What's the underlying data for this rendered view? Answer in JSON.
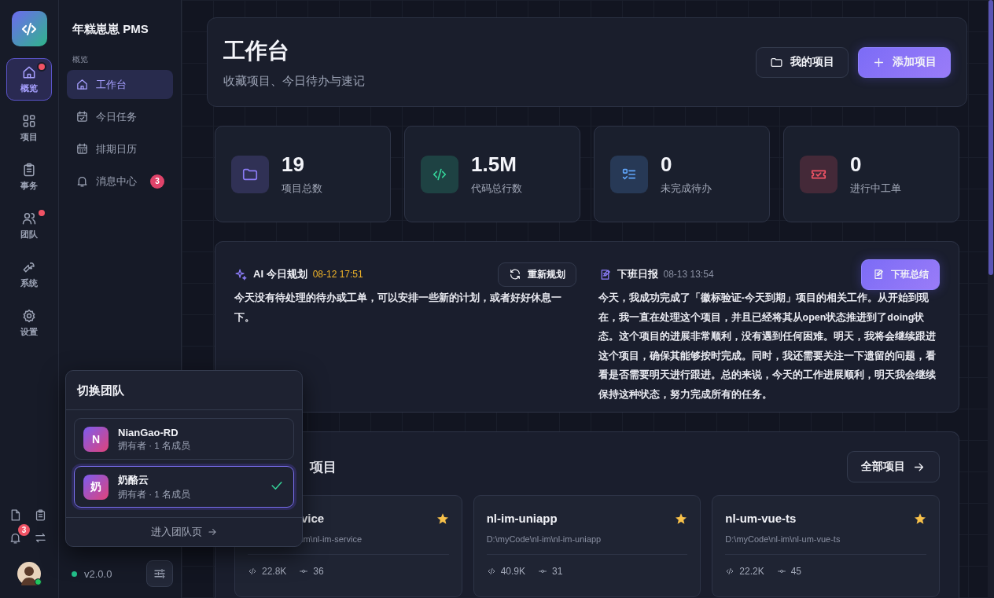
{
  "rail": {
    "items": [
      {
        "label": "概览",
        "selected": true,
        "dot": true
      },
      {
        "label": "项目",
        "selected": false,
        "dot": false
      },
      {
        "label": "事务",
        "selected": false,
        "dot": false
      },
      {
        "label": "团队",
        "selected": false,
        "dot": true
      },
      {
        "label": "系统",
        "selected": false,
        "dot": false
      },
      {
        "label": "设置",
        "selected": false,
        "dot": false
      }
    ],
    "bell_badge": "3",
    "online": true
  },
  "nav": {
    "title": "年糕崽崽 PMS",
    "section": "概览",
    "items": [
      {
        "label": "工作台",
        "selected": true
      },
      {
        "label": "今日任务",
        "selected": false
      },
      {
        "label": "排期日历",
        "selected": false
      },
      {
        "label": "消息中心",
        "selected": false,
        "badge": "3"
      }
    ],
    "version": "v2.0.0"
  },
  "header": {
    "title": "工作台",
    "subtitle": "收藏项目、今日待办与速记",
    "buttons": [
      {
        "label": "我的项目",
        "kind": "secondary"
      },
      {
        "label": "添加项目",
        "kind": "primary"
      }
    ]
  },
  "stats": [
    {
      "value": "19",
      "label": "项目总数",
      "color": "#8b7cf6"
    },
    {
      "value": "1.5M",
      "label": "代码总行数",
      "color": "#34d399"
    },
    {
      "value": "0",
      "label": "未完成待办",
      "color": "#60a5fa"
    },
    {
      "value": "0",
      "label": "进行中工单",
      "color": "#f05365"
    }
  ],
  "ai_plan": {
    "title": "AI 今日规划",
    "time": "08-12 17:51",
    "button": "重新规划",
    "text": "今天没有待处理的待办或工单，可以安排一些新的计划，或者好好休息一下。"
  },
  "daily_report": {
    "title": "下班日报",
    "time": "08-13 13:54",
    "button": "下班总结",
    "text": "今天，我成功完成了「徽标验证-今天到期」项目的相关工作。从开始到现在，我一直在处理这个项目，并且已经将其从open状态推进到了doing状态。这个项目的进展非常顺利，没有遇到任何困难。明天，我将会继续跟进这个项目，确保其能够按时完成。同时，我还需要关注一下遗留的问题，看看是否需要明天进行跟进。总的来说，今天的工作进展顺利，明天我会继续保持这种状态，努力完成所有的任务。"
  },
  "favorites": {
    "title": "项目",
    "button": "全部项目",
    "projects": [
      {
        "name": "vice",
        "path": "im\\nl-im-service",
        "lines": "22.8K",
        "commits": "36",
        "starred": true,
        "partly_hidden": true
      },
      {
        "name": "nl-im-uniapp",
        "path": "D:\\myCode\\nl-im\\nl-im-uniapp",
        "lines": "40.9K",
        "commits": "31",
        "starred": true,
        "partly_hidden": false
      },
      {
        "name": "nl-um-vue-ts",
        "path": "D:\\myCode\\nl-im\\nl-um-vue-ts",
        "lines": "22.2K",
        "commits": "45",
        "starred": true,
        "partly_hidden": false
      }
    ]
  },
  "team_switcher": {
    "title": "切换团队",
    "teams": [
      {
        "initial": "N",
        "name": "NianGao-RD",
        "role": "拥有者 · 1 名成员",
        "selected": false
      },
      {
        "initial": "奶",
        "name": "奶酪云",
        "role": "拥有者 · 1 名成员",
        "selected": true
      }
    ],
    "link": "进入团队页"
  }
}
